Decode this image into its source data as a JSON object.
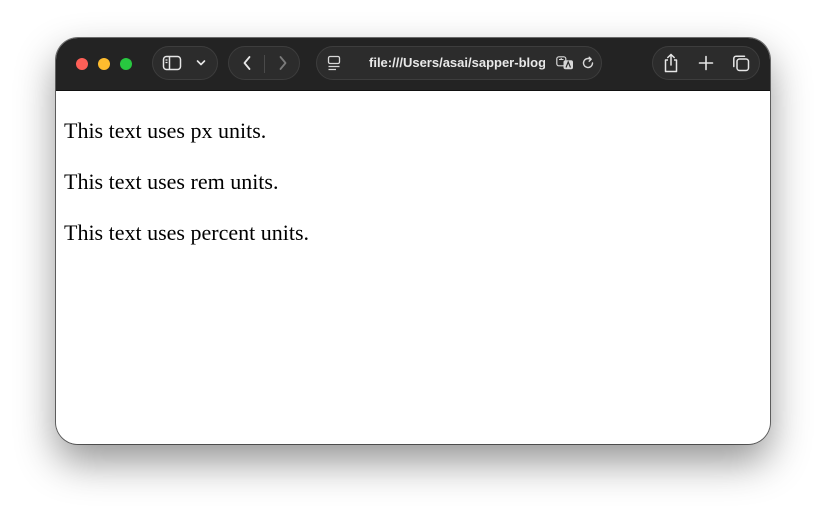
{
  "browser": {
    "address": "file:///Users/asai/sapper-blog",
    "icons": {
      "sidebar": "sidebar-icon",
      "dropdown": "chevron-down-icon",
      "back": "chevron-left-icon",
      "forward": "chevron-right-icon",
      "page_menu": "page-menu-icon",
      "translate": "translate-icon",
      "reload": "reload-icon",
      "share": "share-icon",
      "new_tab": "plus-icon",
      "tabs": "tabs-overview-icon"
    },
    "colors": {
      "toolbar": "#232323",
      "close": "#fe5f57",
      "minimize": "#febc2e",
      "maximize": "#28c840"
    }
  },
  "page": {
    "lines": [
      "This text uses px units.",
      "This text uses rem units.",
      "This text uses percent units."
    ]
  }
}
